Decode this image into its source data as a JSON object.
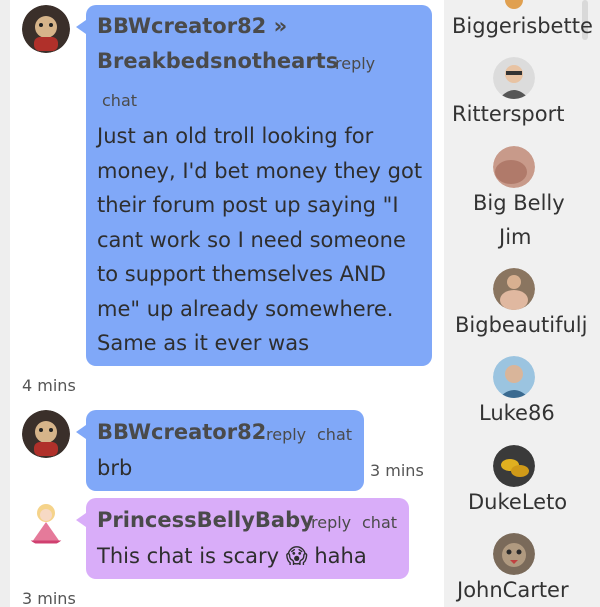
{
  "messages": [
    {
      "username": "BBWcreator82 »",
      "recipient": "Breakbedsnothearts",
      "reply_label": "reply",
      "chat_label": "chat",
      "lines": [
        "Just an old troll looking for",
        "money, I'd bet money they got",
        "their forum post up saying \"I",
        "cant work so I need someone",
        "to support themselves AND",
        "me\" up already somewhere.",
        "Same as it ever was"
      ],
      "time": "4 mins"
    },
    {
      "username": "BBWcreator82",
      "reply_label": "reply",
      "chat_label": "chat",
      "text": "brb",
      "time": "3 mins"
    },
    {
      "username": "PrincessBellyBaby",
      "reply_label": "reply",
      "chat_label": "chat",
      "text_before": "This chat is scary",
      "emoji": "😱",
      "text_after": "haha",
      "time": "3 mins"
    }
  ],
  "users": [
    {
      "name": "Biggerisbette"
    },
    {
      "name": "Rittersport"
    },
    {
      "name_line1": "Big Belly",
      "name_line2": "Jim"
    },
    {
      "name": "Bigbeautifulj"
    },
    {
      "name": "Luke86"
    },
    {
      "name": "DukeLeto"
    },
    {
      "name": "JohnCarter"
    }
  ],
  "colors": {
    "bubble_blue": "#80a8f8",
    "bubble_purple": "#d9adf9",
    "sidebar_bg": "#f0f0f0"
  }
}
